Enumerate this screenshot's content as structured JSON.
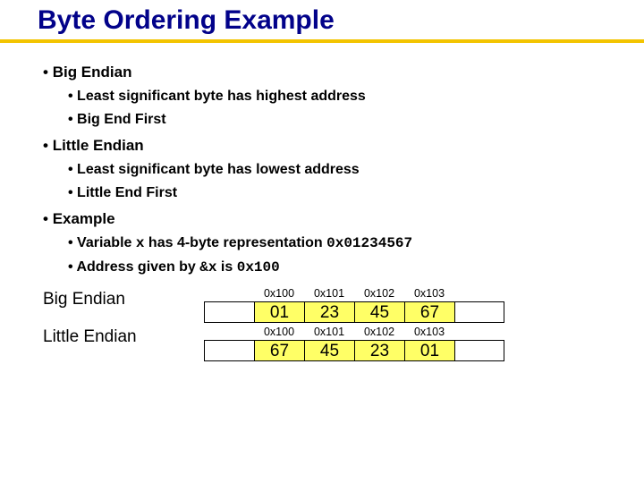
{
  "title": "Byte Ordering Example",
  "bullets": {
    "big": {
      "heading": "Big Endian",
      "sub1": "Least significant byte has highest address",
      "sub2": "Big End First"
    },
    "little": {
      "heading": "Little Endian",
      "sub1": "Least significant byte has lowest address",
      "sub2": "Little End First"
    },
    "example": {
      "heading": "Example",
      "sub1_a": "Variable ",
      "sub1_var": "x",
      "sub1_b": " has 4-byte representation ",
      "sub1_val": "0x01234567",
      "sub2_a": "Address given by ",
      "sub2_var": "&x",
      "sub2_b": " is ",
      "sub2_val": "0x100"
    }
  },
  "tables": {
    "big": {
      "label": "Big Endian",
      "addrs": [
        "0x100",
        "0x101",
        "0x102",
        "0x103"
      ],
      "bytes": [
        "01",
        "23",
        "45",
        "67"
      ]
    },
    "little": {
      "label": "Little Endian",
      "addrs": [
        "0x100",
        "0x101",
        "0x102",
        "0x103"
      ],
      "bytes": [
        "67",
        "45",
        "23",
        "01"
      ]
    }
  }
}
